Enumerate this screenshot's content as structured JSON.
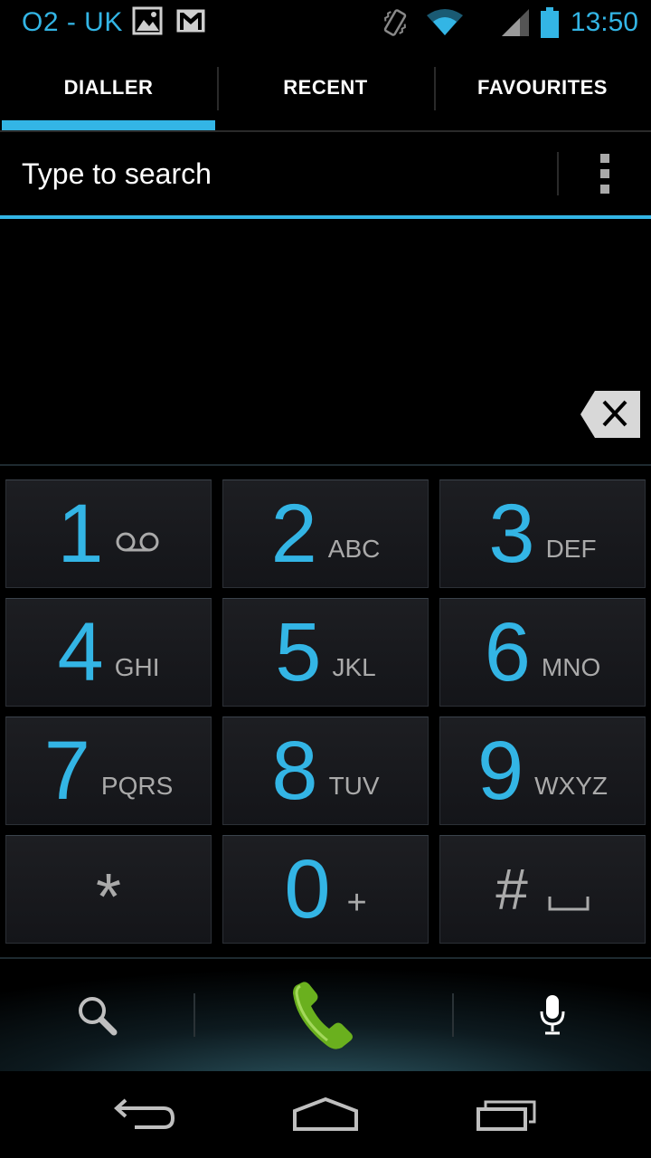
{
  "status_bar": {
    "carrier": "O2 - UK",
    "time": "13:50",
    "left_icons": [
      "gallery-icon",
      "gmail-icon"
    ],
    "right_icons": [
      "vibrate-icon",
      "wifi-icon",
      "signal-icon",
      "battery-icon"
    ]
  },
  "tabs": [
    {
      "label": "DIALLER",
      "active": true
    },
    {
      "label": "RECENT",
      "active": false
    },
    {
      "label": "FAVOURITES",
      "active": false
    }
  ],
  "search": {
    "placeholder": "Type to search",
    "value": ""
  },
  "keypad": {
    "keys": [
      {
        "digit": "1",
        "letters": "",
        "icon": "voicemail-icon"
      },
      {
        "digit": "2",
        "letters": "ABC"
      },
      {
        "digit": "3",
        "letters": "DEF"
      },
      {
        "digit": "4",
        "letters": "GHI"
      },
      {
        "digit": "5",
        "letters": "JKL"
      },
      {
        "digit": "6",
        "letters": "MNO"
      },
      {
        "digit": "7",
        "letters": "PQRS"
      },
      {
        "digit": "8",
        "letters": "TUV"
      },
      {
        "digit": "9",
        "letters": "WXYZ"
      },
      {
        "digit": "*",
        "letters": ""
      },
      {
        "digit": "0",
        "letters": "+"
      },
      {
        "digit": "#",
        "letters": "",
        "icon": "space-icon"
      }
    ]
  },
  "action_bar": {
    "icons": [
      "search-icon",
      "phone-icon",
      "microphone-icon"
    ]
  },
  "nav_bar": {
    "icons": [
      "back-icon",
      "home-icon",
      "recent-apps-icon"
    ]
  },
  "colors": {
    "accent": "#33b5e5",
    "call_green": "#6ab01e",
    "key_bg": "#1a1b1f",
    "secondary_text": "#aaaaaa"
  }
}
